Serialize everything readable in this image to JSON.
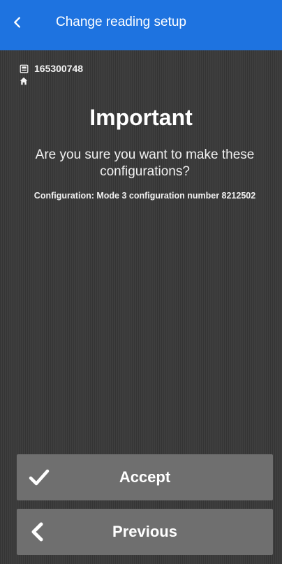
{
  "header": {
    "title": "Change reading setup",
    "back_icon": "chevron-left-icon",
    "background": "#1e73e0"
  },
  "meter": {
    "number": "165300748",
    "icon": "meter-icon",
    "home_icon": "home-icon"
  },
  "dialog": {
    "title": "Important",
    "question": "Are you sure you want to make these configurations?",
    "configuration": "Configuration: Mode 3 configuration number 8212502"
  },
  "actions": {
    "accept_label": "Accept",
    "accept_icon": "checkmark-icon",
    "previous_label": "Previous",
    "previous_icon": "chevron-left-icon"
  },
  "colors": {
    "header": "#1e73e0",
    "background": "#3a3a3a",
    "button": "#6f6f6f",
    "text": "#ffffff"
  }
}
